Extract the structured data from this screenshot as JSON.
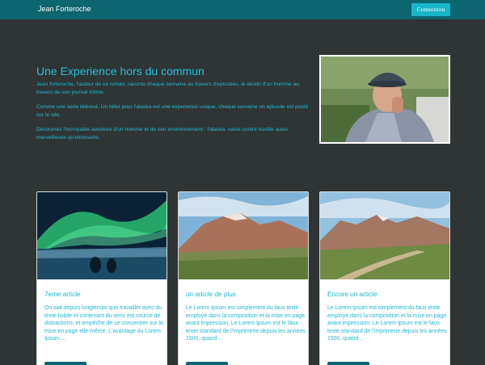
{
  "navbar": {
    "brand": "Jean Forteroche",
    "login_label": "Connexion"
  },
  "hero": {
    "title": "Une Experience hors du commun",
    "paragraphs": [
      "Jean forteroche, l'auteur de ce roman, raconte chaque semaine au travers d'episodes, le destin d'un homme au travers de son journal intime.",
      "Comme une serie télévisé, Un billet pour l'alaska est une experience unique, chaque semaine un episode est posté sur le site.",
      "Découvrez l'incroyable aventure d'un homme et de son environnement : l'alaska, vaste contré hostile aussi merveilleuse qu'etonnante."
    ]
  },
  "cards": [
    {
      "title": "7eme article",
      "excerpt": "On sait depuis longtemps que travailler avec du texte lisible et contenant du sens est source de distractions, et empêche de se concentrer sur la mise en page elle-même. L'avantage du Lorem Ipsum ..."
    },
    {
      "title": "un article de plus",
      "excerpt": "Le Lorem Ipsum est simplement du faux texte employé dans la composition et la mise en page avant impression. Le Lorem Ipsum est le faux texte standard de l'imprimerie depuis les années 1500, quand ..."
    },
    {
      "title": "Encore un article",
      "excerpt": "Le Lorem Ipsum est simplement du faux texte employé dans la composition et la mise en page avant impression. Le Lorem Ipsum est le faux texte standard de l'imprimerie depuis les années 1500, quand ..."
    }
  ],
  "colors": {
    "background": "#2f3434",
    "navbar": "#0d6570",
    "accent": "#19b5c9",
    "text_accent": "#21c3d9"
  }
}
